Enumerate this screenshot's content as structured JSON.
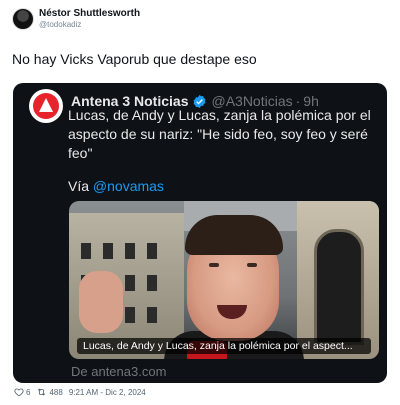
{
  "outer_tweet": {
    "author_name": "Néstor Shuttlesworth",
    "author_handle": "@todokadiz",
    "text": "No hay Vicks Vaporub que destape eso"
  },
  "quoted_tweet": {
    "author_name": "Antena 3 Noticias",
    "author_handle": "@A3Noticias",
    "separator": "·",
    "time": "9h",
    "body": "Lucas, de Andy y Lucas, zanja la polémica por el aspecto de su nariz: \"He sido feo, soy feo y seré feo\"",
    "via_prefix": "Vía ",
    "via_link": "@novamas",
    "media_caption": "Lucas, de Andy y Lucas, zanja la polémica por el aspect...",
    "source_link": "De antena3.com"
  },
  "footer": {
    "likes": "6",
    "retweets": "488",
    "timestamp": "9:21 AM - Dic 2, 2024"
  },
  "colors": {
    "accent": "#1d9bf0",
    "card_bg": "#0e1217",
    "brand_red": "#e7242c"
  },
  "icons": [
    "verified-badge-icon",
    "heart-icon",
    "retweet-icon",
    "antena3-logo"
  ]
}
